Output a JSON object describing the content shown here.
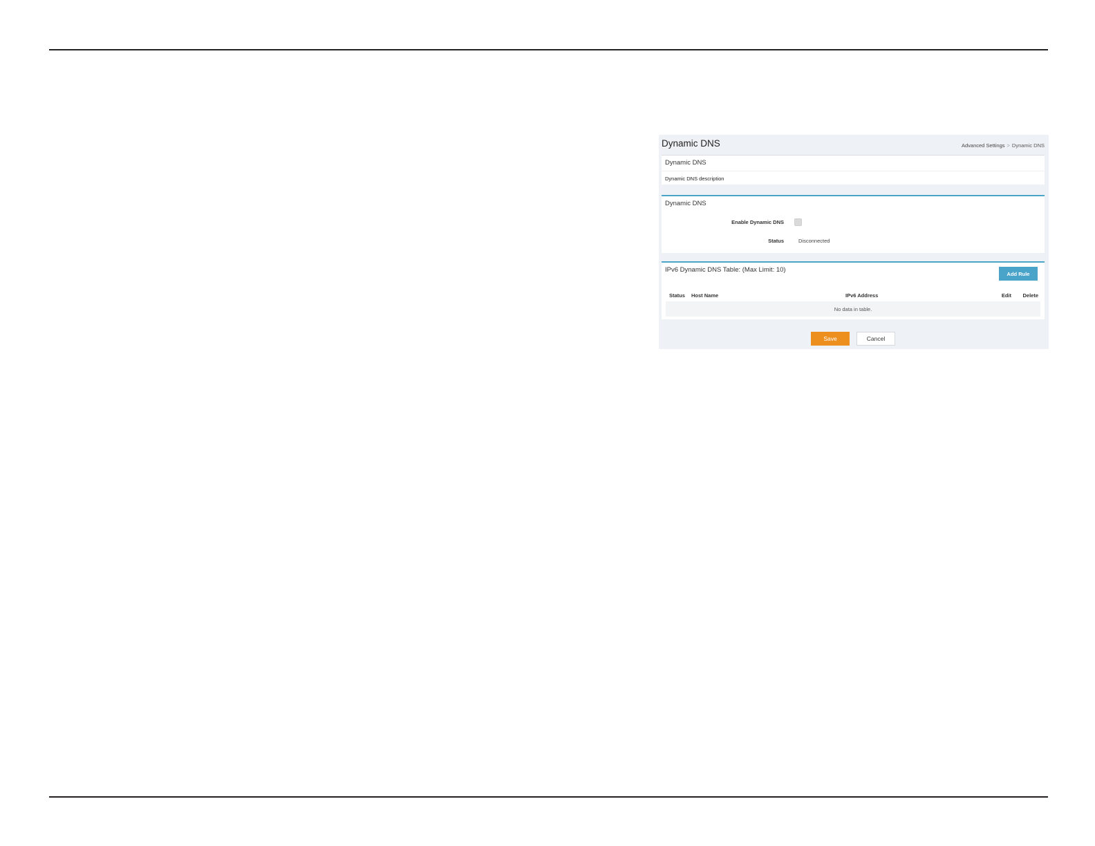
{
  "page": {
    "title": "Dynamic DNS",
    "breadcrumb": [
      "Advanced Settings",
      "Dynamic DNS"
    ],
    "breadcrumb_separator": ">"
  },
  "description_card": {
    "title": "Dynamic DNS",
    "text": "Dynamic DNS description"
  },
  "settings_card": {
    "title": "Dynamic DNS",
    "enable_label": "Enable Dynamic DNS",
    "enable_checked": false,
    "status_label": "Status",
    "status_value": "Disconnected"
  },
  "ipv6_table": {
    "title": "IPv6 Dynamic DNS Table: (Max Limit: 10)",
    "add_button": "Add Rule",
    "columns": [
      "Status",
      "Host Name",
      "IPv6 Address",
      "Edit",
      "Delete"
    ],
    "empty_text": "No data in table."
  },
  "actions": {
    "save_label": "Save",
    "cancel_label": "Cancel"
  },
  "colors": {
    "accent": "#4aa3c9",
    "save": "#ec8f1e",
    "panel_background": "#eef1f5"
  }
}
